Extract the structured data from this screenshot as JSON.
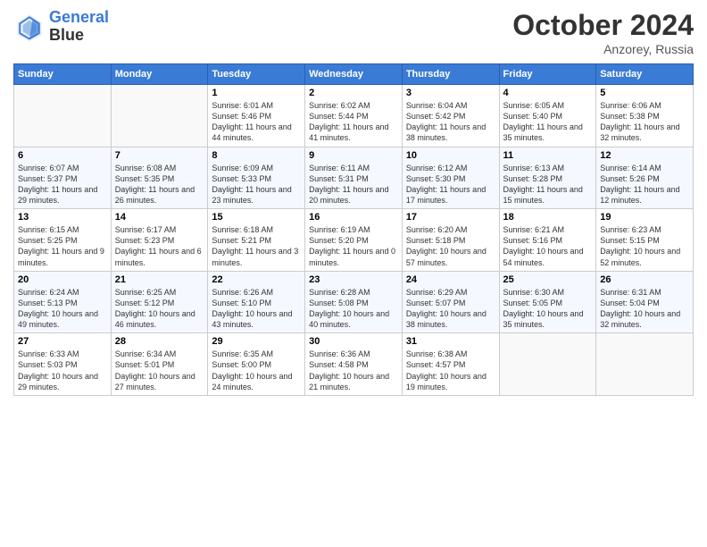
{
  "header": {
    "logo_line1": "General",
    "logo_line2": "Blue",
    "month": "October 2024",
    "location": "Anzorey, Russia"
  },
  "days_of_week": [
    "Sunday",
    "Monday",
    "Tuesday",
    "Wednesday",
    "Thursday",
    "Friday",
    "Saturday"
  ],
  "weeks": [
    [
      {
        "day": "",
        "info": ""
      },
      {
        "day": "",
        "info": ""
      },
      {
        "day": "1",
        "info": "Sunrise: 6:01 AM\nSunset: 5:46 PM\nDaylight: 11 hours and 44 minutes."
      },
      {
        "day": "2",
        "info": "Sunrise: 6:02 AM\nSunset: 5:44 PM\nDaylight: 11 hours and 41 minutes."
      },
      {
        "day": "3",
        "info": "Sunrise: 6:04 AM\nSunset: 5:42 PM\nDaylight: 11 hours and 38 minutes."
      },
      {
        "day": "4",
        "info": "Sunrise: 6:05 AM\nSunset: 5:40 PM\nDaylight: 11 hours and 35 minutes."
      },
      {
        "day": "5",
        "info": "Sunrise: 6:06 AM\nSunset: 5:38 PM\nDaylight: 11 hours and 32 minutes."
      }
    ],
    [
      {
        "day": "6",
        "info": "Sunrise: 6:07 AM\nSunset: 5:37 PM\nDaylight: 11 hours and 29 minutes."
      },
      {
        "day": "7",
        "info": "Sunrise: 6:08 AM\nSunset: 5:35 PM\nDaylight: 11 hours and 26 minutes."
      },
      {
        "day": "8",
        "info": "Sunrise: 6:09 AM\nSunset: 5:33 PM\nDaylight: 11 hours and 23 minutes."
      },
      {
        "day": "9",
        "info": "Sunrise: 6:11 AM\nSunset: 5:31 PM\nDaylight: 11 hours and 20 minutes."
      },
      {
        "day": "10",
        "info": "Sunrise: 6:12 AM\nSunset: 5:30 PM\nDaylight: 11 hours and 17 minutes."
      },
      {
        "day": "11",
        "info": "Sunrise: 6:13 AM\nSunset: 5:28 PM\nDaylight: 11 hours and 15 minutes."
      },
      {
        "day": "12",
        "info": "Sunrise: 6:14 AM\nSunset: 5:26 PM\nDaylight: 11 hours and 12 minutes."
      }
    ],
    [
      {
        "day": "13",
        "info": "Sunrise: 6:15 AM\nSunset: 5:25 PM\nDaylight: 11 hours and 9 minutes."
      },
      {
        "day": "14",
        "info": "Sunrise: 6:17 AM\nSunset: 5:23 PM\nDaylight: 11 hours and 6 minutes."
      },
      {
        "day": "15",
        "info": "Sunrise: 6:18 AM\nSunset: 5:21 PM\nDaylight: 11 hours and 3 minutes."
      },
      {
        "day": "16",
        "info": "Sunrise: 6:19 AM\nSunset: 5:20 PM\nDaylight: 11 hours and 0 minutes."
      },
      {
        "day": "17",
        "info": "Sunrise: 6:20 AM\nSunset: 5:18 PM\nDaylight: 10 hours and 57 minutes."
      },
      {
        "day": "18",
        "info": "Sunrise: 6:21 AM\nSunset: 5:16 PM\nDaylight: 10 hours and 54 minutes."
      },
      {
        "day": "19",
        "info": "Sunrise: 6:23 AM\nSunset: 5:15 PM\nDaylight: 10 hours and 52 minutes."
      }
    ],
    [
      {
        "day": "20",
        "info": "Sunrise: 6:24 AM\nSunset: 5:13 PM\nDaylight: 10 hours and 49 minutes."
      },
      {
        "day": "21",
        "info": "Sunrise: 6:25 AM\nSunset: 5:12 PM\nDaylight: 10 hours and 46 minutes."
      },
      {
        "day": "22",
        "info": "Sunrise: 6:26 AM\nSunset: 5:10 PM\nDaylight: 10 hours and 43 minutes."
      },
      {
        "day": "23",
        "info": "Sunrise: 6:28 AM\nSunset: 5:08 PM\nDaylight: 10 hours and 40 minutes."
      },
      {
        "day": "24",
        "info": "Sunrise: 6:29 AM\nSunset: 5:07 PM\nDaylight: 10 hours and 38 minutes."
      },
      {
        "day": "25",
        "info": "Sunrise: 6:30 AM\nSunset: 5:05 PM\nDaylight: 10 hours and 35 minutes."
      },
      {
        "day": "26",
        "info": "Sunrise: 6:31 AM\nSunset: 5:04 PM\nDaylight: 10 hours and 32 minutes."
      }
    ],
    [
      {
        "day": "27",
        "info": "Sunrise: 6:33 AM\nSunset: 5:03 PM\nDaylight: 10 hours and 29 minutes."
      },
      {
        "day": "28",
        "info": "Sunrise: 6:34 AM\nSunset: 5:01 PM\nDaylight: 10 hours and 27 minutes."
      },
      {
        "day": "29",
        "info": "Sunrise: 6:35 AM\nSunset: 5:00 PM\nDaylight: 10 hours and 24 minutes."
      },
      {
        "day": "30",
        "info": "Sunrise: 6:36 AM\nSunset: 4:58 PM\nDaylight: 10 hours and 21 minutes."
      },
      {
        "day": "31",
        "info": "Sunrise: 6:38 AM\nSunset: 4:57 PM\nDaylight: 10 hours and 19 minutes."
      },
      {
        "day": "",
        "info": ""
      },
      {
        "day": "",
        "info": ""
      }
    ]
  ]
}
